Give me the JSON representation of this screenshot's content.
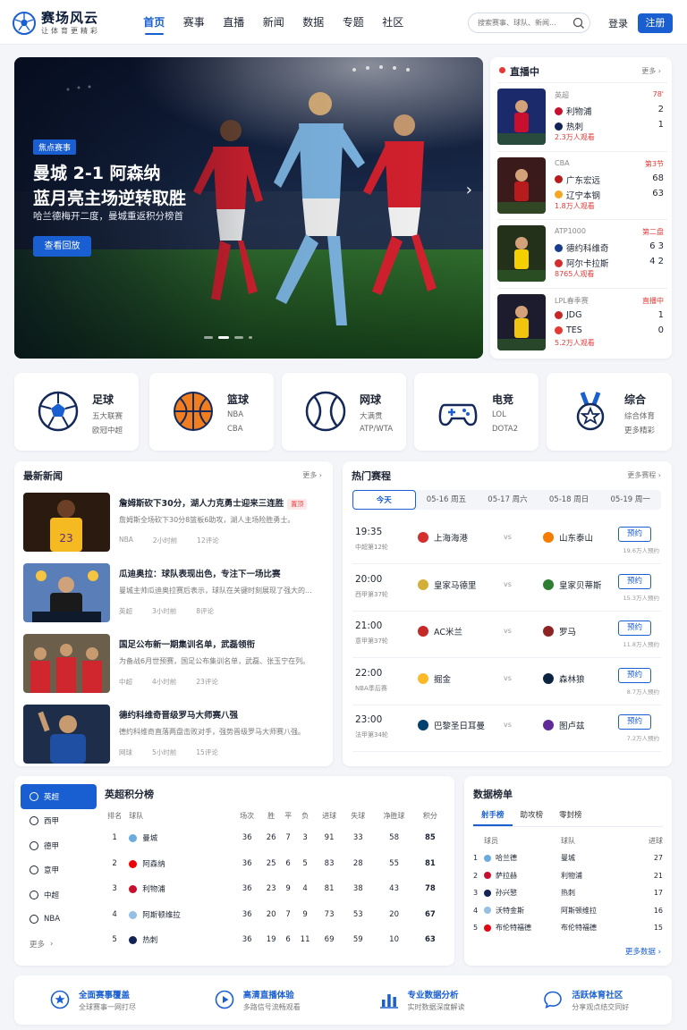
{
  "brand": {
    "name": "赛场风云",
    "tagline": "让体育更精彩"
  },
  "nav": [
    {
      "label": "首页",
      "active": true
    },
    {
      "label": "赛事"
    },
    {
      "label": "直播"
    },
    {
      "label": "新闻"
    },
    {
      "label": "数据"
    },
    {
      "label": "专题"
    },
    {
      "label": "社区"
    }
  ],
  "search": {
    "placeholder": "搜索赛事、球队、新闻..."
  },
  "auth": {
    "login": "登录",
    "register": "注册"
  },
  "hero": {
    "tag": "焦点赛事",
    "title_line1": "曼城 2-1 阿森纳",
    "title_line2": "蓝月亮主场逆转取胜",
    "subtitle": "哈兰德梅开二度，曼城重返积分榜首",
    "button": "查看回放",
    "slide_count": 4,
    "active_slide": 2
  },
  "live": {
    "title": "直播中",
    "more": "更多",
    "matches": [
      {
        "league": "英超",
        "status": "78'",
        "teams": [
          {
            "name": "利物浦",
            "score": "2",
            "color": "#c8102e"
          },
          {
            "name": "热刺",
            "score": "1",
            "color": "#132257"
          }
        ],
        "viewers": "2.3万人观看"
      },
      {
        "league": "CBA",
        "status": "第3节",
        "teams": [
          {
            "name": "广东宏远",
            "score": "68",
            "color": "#b71c1c"
          },
          {
            "name": "辽宁本钢",
            "score": "63",
            "color": "#f5a623"
          }
        ],
        "viewers": "1.8万人观看"
      },
      {
        "league": "ATP1000",
        "status": "第二盘",
        "teams": [
          {
            "name": "德约科维奇",
            "score": "6  3",
            "color": "#1a3c8f"
          },
          {
            "name": "阿尔卡拉斯",
            "score": "4  2",
            "color": "#d32f2f"
          }
        ],
        "viewers": "8765人观看"
      },
      {
        "league": "LPL春季赛",
        "status": "直播中",
        "teams": [
          {
            "name": "JDG",
            "score": "1",
            "color": "#c62828"
          },
          {
            "name": "TES",
            "score": "0",
            "color": "#e53935"
          }
        ],
        "viewers": "5.2万人观看"
      }
    ]
  },
  "categories": [
    {
      "name": "足球",
      "sub1": "五大联赛",
      "sub2": "欧冠中超",
      "icon": "soccer-ball-icon"
    },
    {
      "name": "篮球",
      "sub1": "NBA",
      "sub2": "CBA",
      "icon": "basketball-icon"
    },
    {
      "name": "网球",
      "sub1": "大满贯",
      "sub2": "ATP/WTA",
      "icon": "tennis-ball-icon"
    },
    {
      "name": "电竞",
      "sub1": "LOL",
      "sub2": "DOTA2",
      "icon": "gamepad-icon"
    },
    {
      "name": "综合",
      "sub1": "综合体育",
      "sub2": "更多精彩",
      "icon": "medal-icon"
    }
  ],
  "news": {
    "title": "最新新闻",
    "more": "更多",
    "items": [
      {
        "title": "詹姆斯砍下30分，湖人力克勇士迎来三连胜",
        "hot": "置顶",
        "desc": "詹姆斯全场砍下30分8篮板6助攻，湖人主场险胜勇士。",
        "league": "NBA",
        "time": "2小时前",
        "comments": "12评论"
      },
      {
        "title": "瓜迪奥拉：球队表现出色，专注下一场比赛",
        "hot": "",
        "desc": "曼城主帅瓜迪奥拉赛后表示，球队在关键时刻展现了强大的...",
        "league": "英超",
        "time": "3小时前",
        "comments": "8评论"
      },
      {
        "title": "国足公布新一期集训名单，武磊领衔",
        "hot": "",
        "desc": "为备战6月世预赛，国足公布集训名单，武磊、张玉宁在列。",
        "league": "中超",
        "time": "4小时前",
        "comments": "23评论"
      },
      {
        "title": "德约科维奇晋级罗马大师赛八强",
        "hot": "",
        "desc": "德约科维奇直落两盘击败对手，强势晋级罗马大师赛八强。",
        "league": "网球",
        "time": "5小时前",
        "comments": "15评论"
      }
    ]
  },
  "schedule": {
    "title": "热门赛程",
    "more": "更多赛程",
    "tabs": [
      {
        "label": "今天",
        "active": true
      },
      {
        "label": "05-16 周五"
      },
      {
        "label": "05-17 周六"
      },
      {
        "label": "05-18 周日"
      },
      {
        "label": "05-19 周一"
      }
    ],
    "vs": "vs",
    "games": [
      {
        "time": "19:35",
        "round": "中超第12轮",
        "home": "上海海港",
        "away": "山东泰山",
        "btn": "预约",
        "reserved": "19.6万人预约",
        "home_color": "#d32f2f",
        "away_color": "#f57c00"
      },
      {
        "time": "20:00",
        "round": "西甲第37轮",
        "home": "皇家马德里",
        "away": "皇家贝蒂斯",
        "btn": "预约",
        "reserved": "15.3万人预约",
        "home_color": "#d4af37",
        "away_color": "#2e7d32"
      },
      {
        "time": "21:00",
        "round": "意甲第37轮",
        "home": "AC米兰",
        "away": "罗马",
        "btn": "预约",
        "reserved": "11.8万人预约",
        "home_color": "#c62828",
        "away_color": "#8e2323"
      },
      {
        "time": "22:00",
        "round": "NBA季后赛",
        "home": "掘金",
        "away": "森林狼",
        "btn": "预约",
        "reserved": "8.7万人预约",
        "home_color": "#fdb927",
        "away_color": "#0c2340"
      },
      {
        "time": "23:00",
        "round": "法甲第34轮",
        "home": "巴黎圣日耳曼",
        "away": "图卢兹",
        "btn": "预约",
        "reserved": "7.2万人预约",
        "home_color": "#004170",
        "away_color": "#5e2b97"
      }
    ]
  },
  "standings": {
    "title": "英超积分榜",
    "leagues": [
      {
        "label": "英超",
        "active": true
      },
      {
        "label": "西甲"
      },
      {
        "label": "德甲"
      },
      {
        "label": "意甲"
      },
      {
        "label": "中超"
      },
      {
        "label": "NBA"
      }
    ],
    "league_more": "更多",
    "columns": [
      "排名",
      "球队",
      "场次",
      "胜",
      "平",
      "负",
      "进球",
      "失球",
      "净胜球",
      "积分"
    ],
    "rows": [
      {
        "rank": "1",
        "team": "曼城",
        "color": "#6cabdd",
        "played": "36",
        "w": "26",
        "d": "7",
        "l": "3",
        "gf": "91",
        "ga": "33",
        "gd": "58",
        "pts": "85"
      },
      {
        "rank": "2",
        "team": "阿森纳",
        "color": "#ef0107",
        "played": "36",
        "w": "25",
        "d": "6",
        "l": "5",
        "gf": "83",
        "ga": "28",
        "gd": "55",
        "pts": "81"
      },
      {
        "rank": "3",
        "team": "利物浦",
        "color": "#c8102e",
        "played": "36",
        "w": "23",
        "d": "9",
        "l": "4",
        "gf": "81",
        "ga": "38",
        "gd": "43",
        "pts": "78"
      },
      {
        "rank": "4",
        "team": "阿斯顿维拉",
        "color": "#95bfe5",
        "played": "36",
        "w": "20",
        "d": "7",
        "l": "9",
        "gf": "73",
        "ga": "53",
        "gd": "20",
        "pts": "67"
      },
      {
        "rank": "5",
        "team": "热刺",
        "color": "#132257",
        "played": "36",
        "w": "19",
        "d": "6",
        "l": "11",
        "gf": "69",
        "ga": "59",
        "gd": "10",
        "pts": "63"
      }
    ]
  },
  "ranking": {
    "title": "数据榜单",
    "tabs": [
      {
        "label": "射手榜",
        "active": true
      },
      {
        "label": "助攻榜"
      },
      {
        "label": "零封榜"
      }
    ],
    "columns": [
      "球员",
      "球队",
      "进球"
    ],
    "rows": [
      {
        "rank": "1",
        "player": "哈兰德",
        "team": "曼城",
        "goals": "27",
        "color": "#6cabdd"
      },
      {
        "rank": "2",
        "player": "萨拉赫",
        "team": "利物浦",
        "goals": "21",
        "color": "#c8102e"
      },
      {
        "rank": "3",
        "player": "孙兴慜",
        "team": "热刺",
        "goals": "17",
        "color": "#132257"
      },
      {
        "rank": "4",
        "player": "沃特金斯",
        "team": "阿斯顿维拉",
        "goals": "16",
        "color": "#95bfe5"
      },
      {
        "rank": "5",
        "player": "布伦特福德",
        "team": "布伦特福德",
        "goals": "15",
        "color": "#e30613"
      }
    ],
    "more": "更多数据"
  },
  "features": [
    {
      "title": "全面赛事覆盖",
      "sub": "全球赛事一网打尽",
      "icon": "star-circle-icon"
    },
    {
      "title": "高清直播体验",
      "sub": "多路信号流畅观看",
      "icon": "play-circle-icon"
    },
    {
      "title": "专业数据分析",
      "sub": "实时数据深度解读",
      "icon": "bar-chart-icon"
    },
    {
      "title": "活跃体育社区",
      "sub": "分享观点结交同好",
      "icon": "chat-bubble-icon"
    }
  ],
  "colors": {
    "accent": "#1a5fd1",
    "live": "#e53935"
  }
}
